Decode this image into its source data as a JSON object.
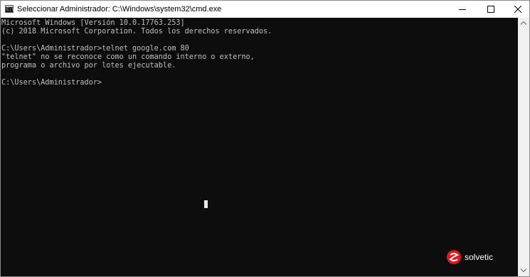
{
  "window": {
    "title": "Seleccionar Administrador: C:\\Windows\\system32\\cmd.exe",
    "icon": "cmd-console-icon",
    "icon_glyph": "C:\\",
    "controls": [
      "minimize-icon",
      "maximize-icon",
      "close-icon"
    ]
  },
  "console": {
    "lines": [
      "Microsoft Windows [Versión 10.0.17763.253]",
      "(c) 2018 Microsoft Corporation. Todos los derechos reservados.",
      "",
      "C:\\Users\\Administrador>telnet google.com 80",
      "\"telnet\" no se reconoce como un comando interno o externo,",
      "programa o archivo por lotes ejecutable.",
      "",
      "C:\\Users\\Administrador>"
    ],
    "background": "#0c0c0c",
    "foreground": "#c0c0c0"
  },
  "watermark": {
    "text": "solvetic",
    "brand_color": "#e2161d"
  }
}
